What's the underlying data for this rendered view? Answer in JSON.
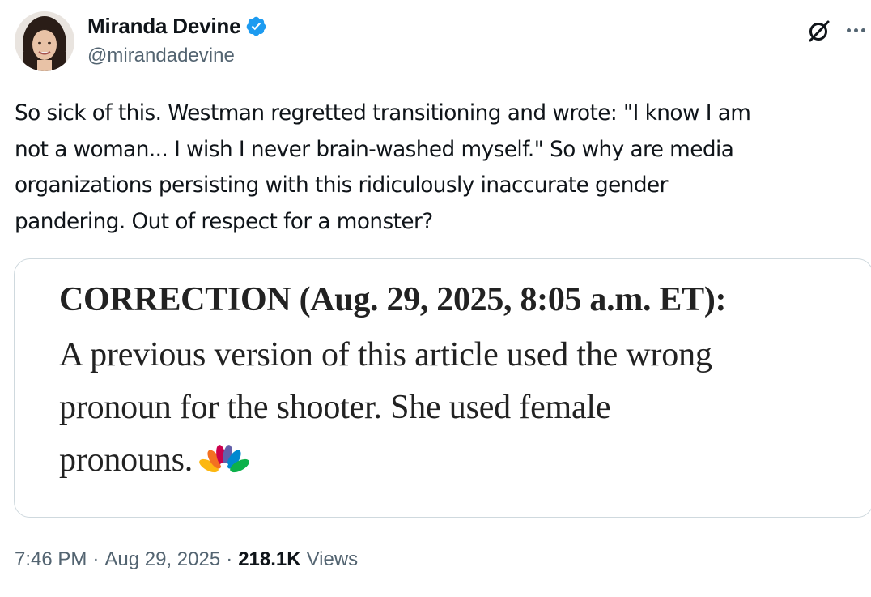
{
  "author": {
    "display_name": "Miranda Devine",
    "handle": "@mirandadevine",
    "verified": true,
    "verified_color": "#1d9bf0"
  },
  "tweet": {
    "text": "So sick of this. Westman regretted transitioning and wrote: \"I know I am\nnot a woman... I wish I never brain-washed myself.\" So why are media\norganizations persisting with this ridiculously inaccurate gender\npandering. Out of respect for a monster?"
  },
  "media": {
    "heading": "CORRECTION (Aug. 29, 2025, 8:05 a.m. ET):",
    "body_line1": "A previous version of this article used the wrong",
    "body_line2": "pronoun for the shooter. She used female",
    "body_line3": "pronouns.",
    "logo_icon": "nbc-peacock-icon"
  },
  "meta": {
    "time": "7:46 PM",
    "separator": "·",
    "date": "Aug 29, 2025",
    "views_count": "218.1K",
    "views_label": "Views"
  },
  "icons": {
    "grok": "grok-icon",
    "more": "more-options-icon"
  }
}
